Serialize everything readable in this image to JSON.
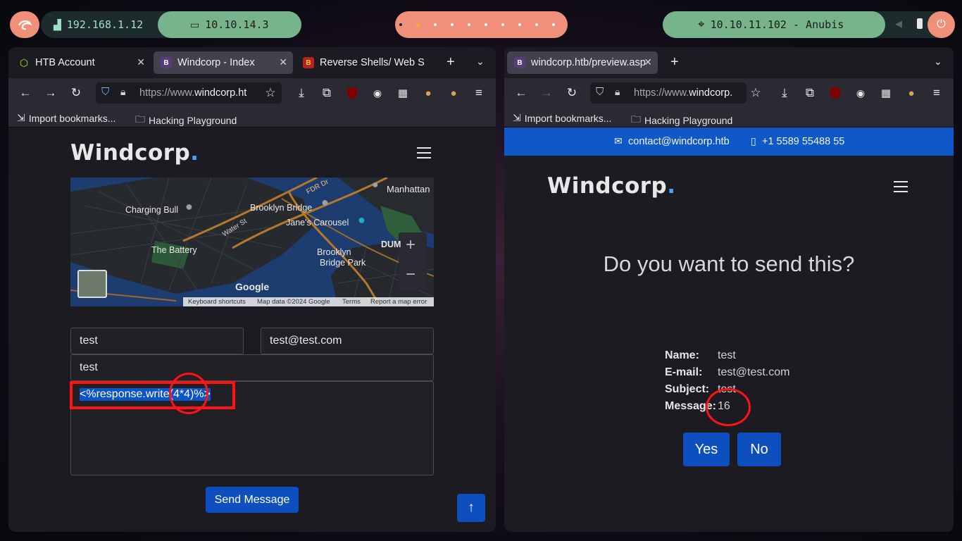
{
  "topbar": {
    "local_ip": "192.168.1.12",
    "vpn_ip": "10.10.14.3",
    "target": "10.10.11.102 - Anubis"
  },
  "left_window": {
    "tabs": [
      {
        "label": "HTB Account",
        "favicon": "htb-cube-icon"
      },
      {
        "label": "Windcorp - Index",
        "favicon": "bootstrap-icon"
      },
      {
        "label": "Reverse Shells/ Web S",
        "favicon": "burp-icon"
      }
    ],
    "url": {
      "prefix": "https://www.",
      "host": "windcorp.ht"
    },
    "bookmarks": [
      "Import bookmarks...",
      "Hacking Playground"
    ],
    "page": {
      "logo": "Windcorp",
      "logo_dot": ".",
      "map": {
        "labels": [
          "Manhattan",
          "FDR Dr",
          "Charging Bull",
          "Brooklyn Bridge",
          "Jane's Carousel",
          "Water St",
          "The Battery",
          "Brooklyn",
          "Bridge Park",
          "DUM"
        ],
        "google": "Google",
        "footer": [
          "Keyboard shortcuts",
          "Map data ©2024 Google",
          "Terms",
          "Report a map error"
        ]
      },
      "form": {
        "name": "test",
        "email": "test@test.com",
        "subject": "test",
        "message": "<%response.write(4*4)%>",
        "send_label": "Send Message"
      }
    }
  },
  "right_window": {
    "tabs": [
      {
        "label": "windcorp.htb/preview.asp",
        "favicon": "bootstrap-icon"
      }
    ],
    "url": {
      "prefix": "https://www.",
      "host": "windcorp."
    },
    "bookmarks": [
      "Import bookmarks...",
      "Hacking Playground"
    ],
    "page": {
      "contact_email": "contact@windcorp.htb",
      "contact_phone": "+1 5589 55488 55",
      "logo": "Windcorp",
      "logo_dot": ".",
      "question": "Do you want to send this?",
      "details": [
        {
          "key": "Name:",
          "value": "test"
        },
        {
          "key": "E-mail:",
          "value": "test@test.com"
        },
        {
          "key": "Subject:",
          "value": "test"
        },
        {
          "key": "Message:",
          "value": "16"
        }
      ],
      "yes_label": "Yes",
      "no_label": "No"
    }
  },
  "colors": {
    "accent_blue": "#0d4fbf",
    "annotation_red": "#ff1212",
    "pill_green": "#77b48c",
    "pill_salmon": "#f0907a"
  }
}
